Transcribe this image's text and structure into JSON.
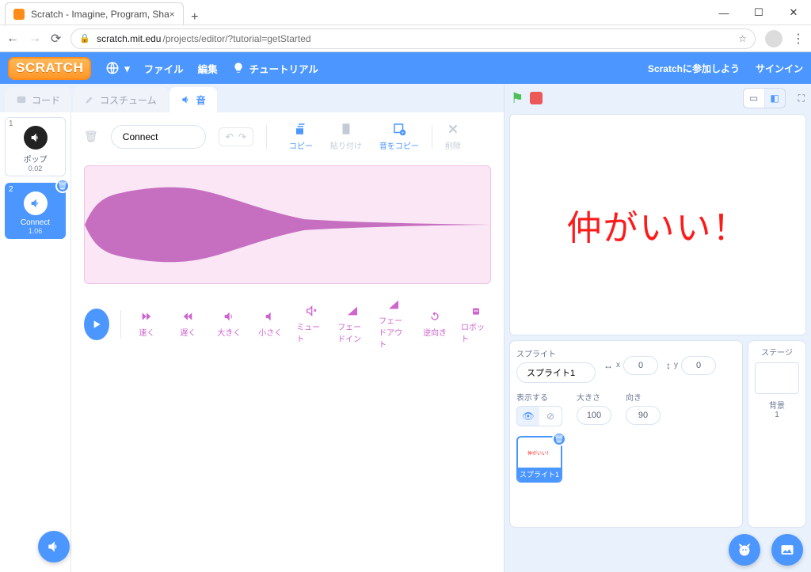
{
  "browser": {
    "tab_title": "Scratch - Imagine, Program, Sha",
    "url_domain": "scratch.mit.edu",
    "url_path": "/projects/editor/?tutorial=getStarted"
  },
  "menubar": {
    "logo": "SCRATCH",
    "file": "ファイル",
    "edit": "編集",
    "tutorials": "チュートリアル",
    "join": "Scratchに参加しよう",
    "signin": "サインイン"
  },
  "tabs": {
    "code": "コード",
    "costumes": "コスチューム",
    "sounds": "音"
  },
  "sounds": {
    "items": [
      {
        "idx": "1",
        "name": "ポップ",
        "duration": "0.02"
      },
      {
        "idx": "2",
        "name": "Connect",
        "duration": "1.06"
      }
    ],
    "selected_name": "Connect"
  },
  "sound_editor": {
    "copy": "コピー",
    "paste": "貼り付け",
    "copy_new": "音をコピー",
    "delete": "削除",
    "faster": "速く",
    "slower": "遅く",
    "louder": "大きく",
    "softer": "小さく",
    "mute": "ミュート",
    "fadein": "フェードイン",
    "fadeout": "フェードアウト",
    "reverse": "逆向き",
    "robot": "ロボット"
  },
  "stage": {
    "text": "仲がいい！"
  },
  "sprite_panel": {
    "sprite_label": "スプライト",
    "sprite_name": "スプライト1",
    "x_label": "x",
    "x_value": "0",
    "y_label": "y",
    "y_value": "0",
    "show_label": "表示する",
    "size_label": "大きさ",
    "size_value": "100",
    "direction_label": "向き",
    "direction_value": "90",
    "thumb_name": "スプライト1",
    "thumb_text": "仲がいい！"
  },
  "stage_panel": {
    "label": "ステージ",
    "backdrops_label": "背景",
    "backdrops_count": "1"
  }
}
